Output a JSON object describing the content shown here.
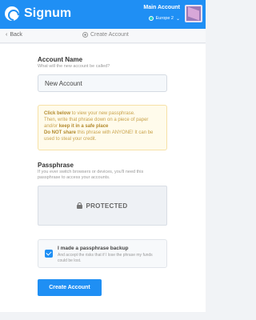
{
  "header": {
    "app_name": "Signum",
    "account_name": "Main Account",
    "network": "Europe 2"
  },
  "subbar": {
    "back_label": "Back",
    "title": "Create Account"
  },
  "form": {
    "account_name_label": "Account Name",
    "account_name_hint": "What will the new account be called?",
    "account_name_value": "New Account",
    "warning": {
      "line1_bold": "Click below",
      "line1_rest": " to view your new passphrase.",
      "line2_a": "Then, write that phrase down on a piece of paper and/or ",
      "line2_bold": "keep it in a safe place",
      "line3_bold": "Do NOT share",
      "line3_rest": " this phrase with ANYONE! It can be used to steal your credit."
    },
    "passphrase_label": "Passphrase",
    "passphrase_hint": "If you ever switch browsers or devices, you'll need this passphrase to access your accounts.",
    "protected_text": "PROTECTED",
    "backup_title": "I made a passphrase backup",
    "backup_desc": "And accept the risks that if I lose the phrase my funds could be lost.",
    "backup_checked": true,
    "create_button": "Create Account"
  },
  "colors": {
    "accent": "#1f8ff4",
    "warning_bg": "#fffbeb",
    "warning_text": "#c9a24a"
  }
}
